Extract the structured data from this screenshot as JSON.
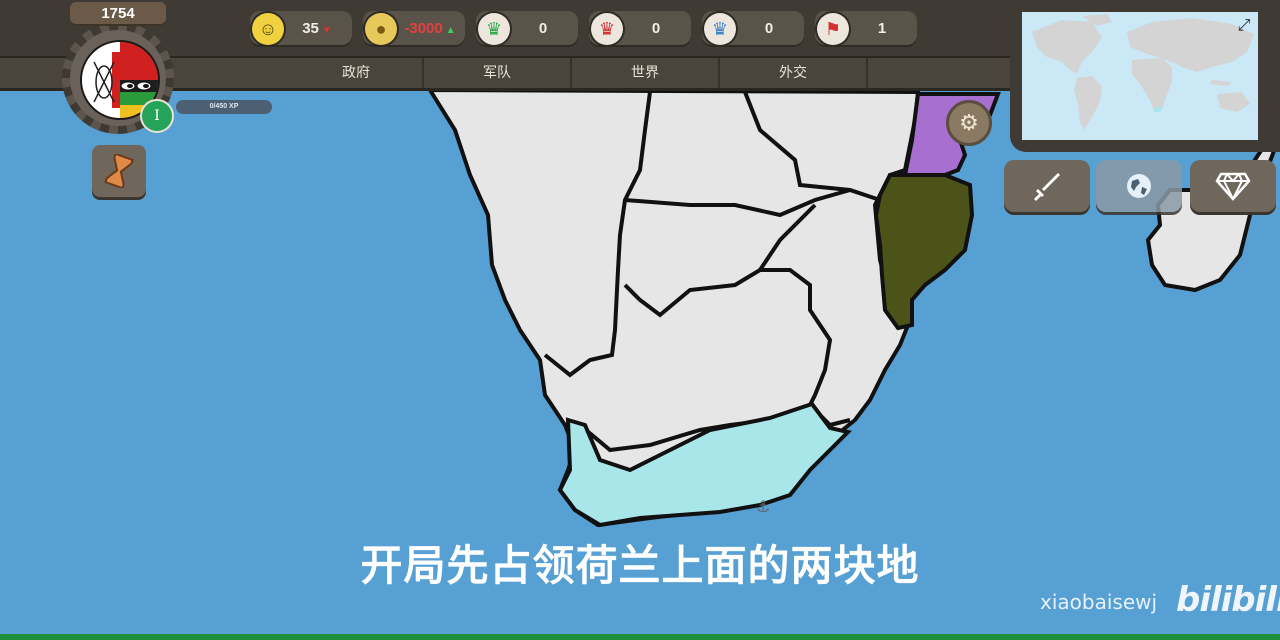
{
  "top_bar": {
    "year": "1754",
    "xp_text": "0/450 XP",
    "level": "I",
    "resources": [
      {
        "name": "stability",
        "icon": "smiley-icon",
        "value": "35",
        "trend": "down"
      },
      {
        "name": "gold",
        "icon": "coins-icon",
        "value": "-3000",
        "trend": "up"
      },
      {
        "name": "green-crown",
        "icon": "crown-icon",
        "value": "0"
      },
      {
        "name": "red-crown",
        "icon": "crown-icon",
        "value": "0"
      },
      {
        "name": "blue-crown",
        "icon": "crown-icon",
        "value": "0"
      },
      {
        "name": "flag-count",
        "icon": "flag-icon",
        "value": "1"
      }
    ],
    "tabs": [
      "政府",
      "军队",
      "世界",
      "外交"
    ]
  },
  "colors": {
    "sea": "#57a0d3",
    "land_neutral": "#e6e6e6",
    "player_territory": "#a8e6ea",
    "purple_nation": "#a76fd0",
    "olive_nation": "#4b5319",
    "ui_dark": "#3f3a33"
  },
  "subtitle": "开局先占领荷兰上面的两块地",
  "watermark": {
    "user": "xiaobaisewj",
    "logo": "bilibili"
  }
}
